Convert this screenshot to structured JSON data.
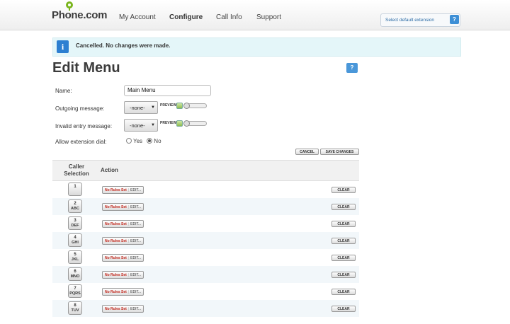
{
  "header": {
    "logo": "Phone.com",
    "nav": [
      "My Account",
      "Configure",
      "Call Info",
      "Support"
    ],
    "active_nav": "Configure",
    "extension_select": "Select default extension",
    "extension_help": "?"
  },
  "alert": {
    "icon": "i",
    "message": "Cancelled. No changes were made."
  },
  "page": {
    "title": "Edit Menu",
    "help": "?"
  },
  "form": {
    "name_label": "Name:",
    "name_value": "Main Menu",
    "outgoing_label": "Outgoing message:",
    "outgoing_value": "-none-",
    "invalid_label": "Invalid entry message:",
    "invalid_value": "-none-",
    "preview_label": "PREVIEW",
    "allow_label": "Allow extension dial:",
    "allow_options": [
      "Yes",
      "No"
    ],
    "allow_selected": "No",
    "cancel_button": "CANCEL",
    "save_button": "SAVE CHANGES"
  },
  "table": {
    "headers": [
      "Caller Selection",
      "Action"
    ],
    "no_rules_label": "No Rules Set",
    "edit_label": "EDIT...",
    "clear_label": "CLEAR",
    "rows": [
      {
        "num": "1",
        "letters": ""
      },
      {
        "num": "2",
        "letters": "ABC"
      },
      {
        "num": "3",
        "letters": "DEF"
      },
      {
        "num": "4",
        "letters": "GHI"
      },
      {
        "num": "5",
        "letters": "JKL"
      },
      {
        "num": "6",
        "letters": "MNO"
      },
      {
        "num": "7",
        "letters": "PQRS"
      },
      {
        "num": "8",
        "letters": "TUV"
      }
    ]
  },
  "colors": {
    "accent": "#2d7fd1",
    "brand": "#7ab51d",
    "alert_bg": "#e4f6f9",
    "no_rules": "#c0271c",
    "row_alt": "#f2f7fa"
  },
  "icons": [
    "logo-pin-icon",
    "info-icon",
    "help-icon",
    "chevron-down-icon",
    "play-icon"
  ]
}
